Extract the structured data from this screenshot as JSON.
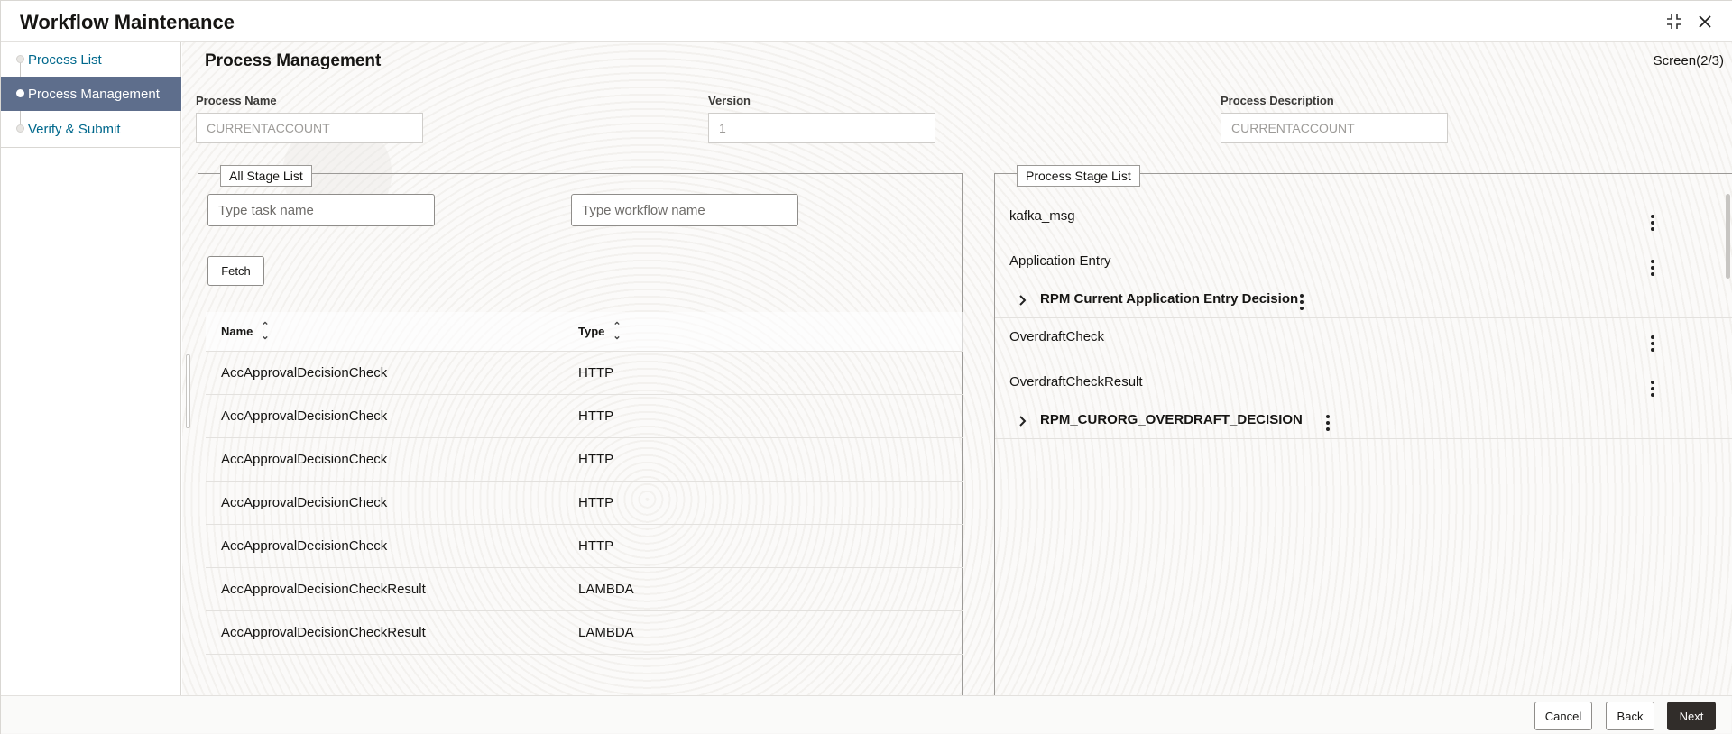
{
  "header": {
    "title": "Workflow Maintenance",
    "minimize_icon": "compress-icon",
    "close_icon": "close-icon"
  },
  "sidebar": {
    "items": [
      {
        "label": "Process List",
        "active": false
      },
      {
        "label": "Process Management",
        "active": true
      },
      {
        "label": "Verify & Submit",
        "active": false
      }
    ]
  },
  "main": {
    "title": "Process Management",
    "screen_indicator": "Screen(2/3)",
    "fields": {
      "process_name": {
        "label": "Process Name",
        "value": "CURRENTACCOUNT"
      },
      "version": {
        "label": "Version",
        "value": "1"
      },
      "process_description": {
        "label": "Process Description",
        "value": "CURRENTACCOUNT"
      }
    }
  },
  "all_stage_list": {
    "legend": "All Stage List",
    "task_search_placeholder": "Type task name",
    "workflow_search_placeholder": "Type workflow name",
    "fetch_label": "Fetch",
    "columns": [
      "Name",
      "Type"
    ],
    "rows": [
      {
        "name": "AccApprovalDecisionCheck",
        "type": "HTTP"
      },
      {
        "name": "AccApprovalDecisionCheck",
        "type": "HTTP"
      },
      {
        "name": "AccApprovalDecisionCheck",
        "type": "HTTP"
      },
      {
        "name": "AccApprovalDecisionCheck",
        "type": "HTTP"
      },
      {
        "name": "AccApprovalDecisionCheck",
        "type": "HTTP"
      },
      {
        "name": "AccApprovalDecisionCheckResult",
        "type": "LAMBDA"
      },
      {
        "name": "AccApprovalDecisionCheckResult",
        "type": "LAMBDA"
      }
    ]
  },
  "process_stage_list": {
    "legend": "Process Stage List",
    "stages": [
      {
        "label": "kafka_msg"
      },
      {
        "label": "Application Entry"
      },
      {
        "label": "RPM Current Application Entry Decision",
        "decision": true
      },
      {
        "label": "OverdraftCheck"
      },
      {
        "label": "OverdraftCheckResult"
      },
      {
        "label": "RPM_CURORG_OVERDRAFT_DECISION",
        "decision": true
      }
    ]
  },
  "footer": {
    "cancel_label": "Cancel",
    "back_label": "Back",
    "next_label": "Next"
  }
}
